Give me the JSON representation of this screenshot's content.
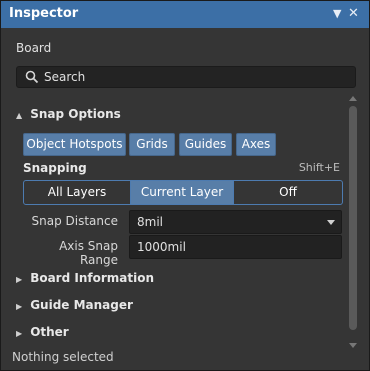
{
  "window": {
    "title": "Inspector",
    "menu_icon": "dropdown-arrow-icon",
    "close_icon": "close-icon"
  },
  "board_label": "Board",
  "search": {
    "placeholder": "Search"
  },
  "snap_options": {
    "title": "Snap Options",
    "chips": [
      "Object Hotspots",
      "Grids",
      "Guides",
      "Axes"
    ],
    "snapping_label": "Snapping",
    "shortcut": "Shift+E",
    "segments": [
      "All Layers",
      "Current Layer",
      "Off"
    ],
    "selected_segment": "Current Layer",
    "snap_distance": {
      "label": "Snap Distance",
      "value": "8mil"
    },
    "axis_snap_range": {
      "label": "Axis Snap Range",
      "value": "1000mil"
    }
  },
  "collapsed_sections": [
    "Board Information",
    "Guide Manager",
    "Other"
  ],
  "status": "Nothing selected",
  "colors": {
    "titlebar": "#3c6fa6",
    "chip": "#587ea8",
    "selected_segment": "#587ea8",
    "background": "#353535"
  }
}
